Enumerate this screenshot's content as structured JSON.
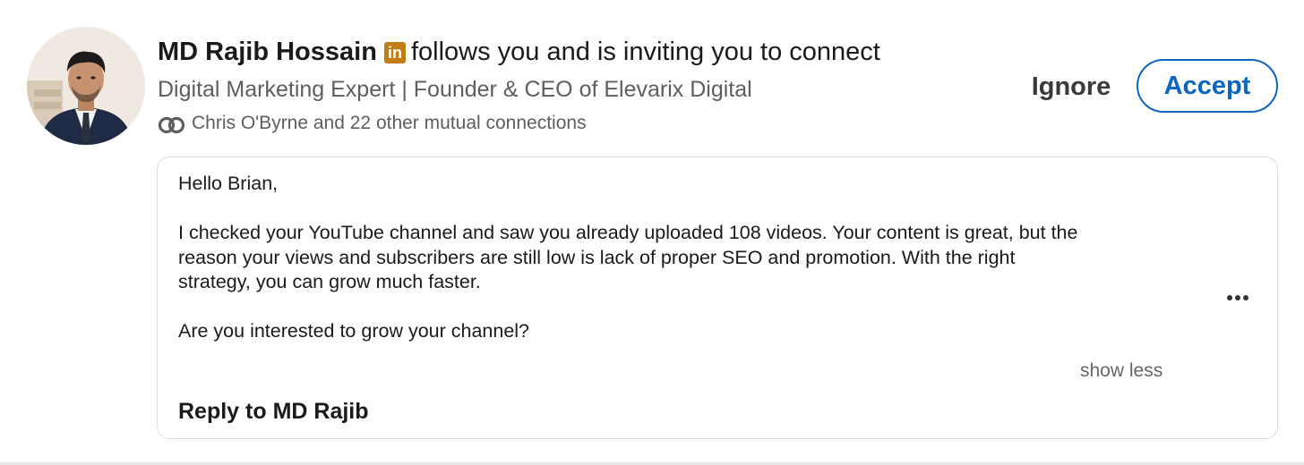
{
  "invitation": {
    "sender_name": "MD Rajib Hossain",
    "badge_glyph": "in",
    "action_text": "follows you and is inviting you to connect",
    "headline": "Digital Marketing Expert | Founder & CEO of Elevarix Digital",
    "mutual_connections": "Chris O'Byrne and 22 other mutual connections"
  },
  "actions": {
    "ignore_label": "Ignore",
    "accept_label": "Accept"
  },
  "message": {
    "greeting": "Hello Brian,",
    "body": "I checked your YouTube channel and saw you already uploaded 108 videos. Your content is great, but the\nreason your views and subscribers are still low is lack of proper SEO and promotion. With the right\nstrategy, you can grow much faster.",
    "question": "Are you interested to grow your channel?",
    "show_less_label": "show less",
    "reply_label": "Reply to MD Rajib"
  },
  "icons": {
    "badge": "linkedin-premium-icon",
    "mutual": "mutual-connections-icon",
    "more": "more-options-icon"
  },
  "colors": {
    "accent_blue": "#0a66c2",
    "premium_gold": "#c17d13",
    "secondary_text": "#5e5e5e",
    "border": "#dcdcdc"
  }
}
